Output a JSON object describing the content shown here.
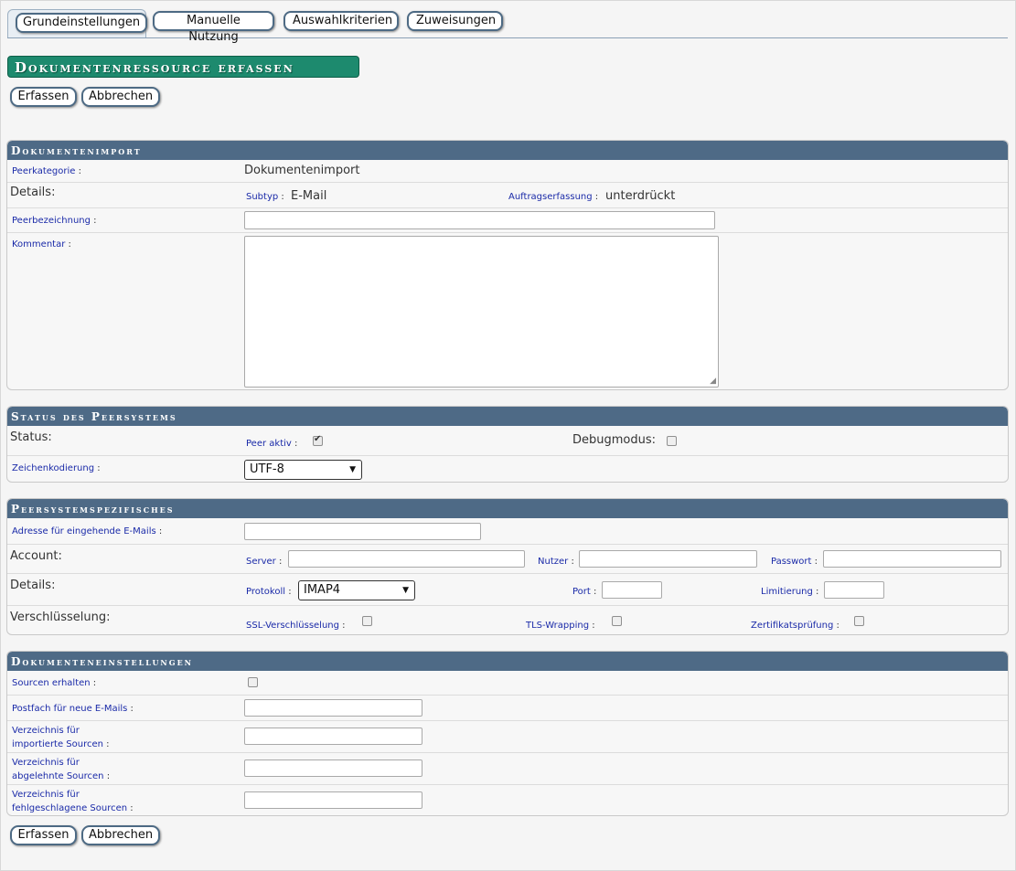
{
  "tabs": [
    {
      "label": "Grundeinstellungen",
      "active": true
    },
    {
      "label": "Manuelle Nutzung"
    },
    {
      "label": "Auswahlkriterien"
    },
    {
      "label": "Zuweisungen"
    }
  ],
  "page_title": "Dokumentenressource erfassen",
  "actions": {
    "create": "Erfassen",
    "cancel": "Abbrechen"
  },
  "sections": {
    "import": {
      "title": "Dokumentenimport",
      "peerkategorie_label": "Peerkategorie",
      "peerkategorie_value": "Dokumentenimport",
      "details_label": "Details:",
      "subtyp_label": "Subtyp",
      "subtyp_value": "E-Mail",
      "auftrag_label": "Auftragserfassung",
      "auftrag_value": "unterdrückt",
      "peerbez_label": "Peerbezeichnung",
      "peerbez_value": "",
      "kommentar_label": "Kommentar",
      "kommentar_value": ""
    },
    "status": {
      "title": "Status des Peersystems",
      "status_label": "Status:",
      "peer_aktiv_label": "Peer aktiv",
      "peer_aktiv_checked": true,
      "debug_label": "Debugmodus:",
      "debug_checked": false,
      "encoding_label": "Zeichenkodierung",
      "encoding_value": "UTF-8"
    },
    "peer": {
      "title": "Peersystemspezifisches",
      "incoming_label": "Adresse für eingehende E-Mails",
      "incoming_value": "",
      "account_label": "Account:",
      "server_label": "Server",
      "nutzer_label": "Nutzer",
      "passwort_label": "Passwort",
      "details_label": "Details:",
      "protokoll_label": "Protokoll",
      "protokoll_value": "IMAP4",
      "port_label": "Port",
      "limit_label": "Limitierung",
      "crypto_label": "Verschlüsselung:",
      "ssl_label": "SSL-Verschlüsselung",
      "tls_label": "TLS-Wrapping",
      "cert_label": "Zertifikatsprüfung"
    },
    "docs": {
      "title": "Dokumenteneinstellungen",
      "keep_label": "Sourcen erhalten",
      "inbox_label": "Postfach für neue E-Mails",
      "imported_label_1": "Verzeichnis für",
      "imported_label_2": "importierte Sourcen",
      "rejected_label_1": "Verzeichnis für",
      "rejected_label_2": "abgelehnte Sourcen",
      "failed_label_1": "Verzeichnis für",
      "failed_label_2": "fehlgeschlagene Sourcen"
    }
  },
  "colors": {
    "title_bg": "#1d8a6e",
    "panel_head": "#4e6a86",
    "label_link": "#1a2aa8"
  }
}
